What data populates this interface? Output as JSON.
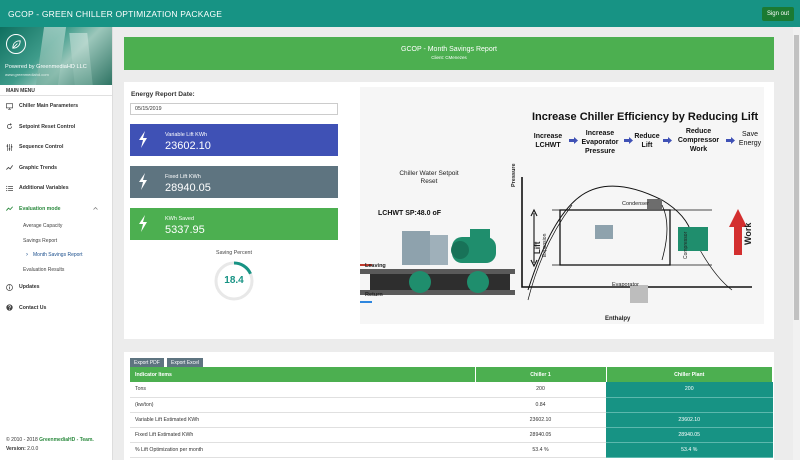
{
  "app": {
    "title": "GCOP - GREEN CHILLER OPTIMIZATION PACKAGE",
    "signout": "Sign out"
  },
  "brand": {
    "powered": "Powered by GreenmediaHD LLC",
    "site": "www.greenmediahd.com"
  },
  "sidebar": {
    "main_menu": "MAIN MENU",
    "items": [
      {
        "label": "Chiller Main Parameters",
        "icon": "monitor-icon"
      },
      {
        "label": "Setpoint Reset Control",
        "icon": "reset-icon"
      },
      {
        "label": "Sequence Control",
        "icon": "sliders-icon"
      },
      {
        "label": "Graphic Trends",
        "icon": "trend-icon"
      },
      {
        "label": "Additional Variables",
        "icon": "list-icon"
      },
      {
        "label": "Evaluation mode",
        "icon": "chart-line-icon"
      }
    ],
    "sub_items": [
      "Average Capacity",
      "Savings Report",
      "Month Savings Report",
      "Evaluation Results"
    ],
    "items_after": [
      {
        "label": "Updates",
        "icon": "info-icon"
      },
      {
        "label": "Contact Us",
        "icon": "help-icon"
      }
    ],
    "footer_copyright": "© 2010 - 2018 ",
    "footer_org": "GreenmediaHD - Team.",
    "footer_version_label": "Version: ",
    "footer_version": "2.0.0"
  },
  "report": {
    "title": "GCOP - Month Savings Report",
    "client": "Client: CMenezes"
  },
  "energy": {
    "date_label": "Energy Report Date:",
    "date_value": "05/15/2019",
    "variable_label": "Variable Lift KWh",
    "variable_value": "23602.10",
    "fixed_label": "Fixed Lift KWh",
    "fixed_value": "28940.05",
    "saved_label": "KWh Saved",
    "saved_value": "5337.95",
    "saving_percent_label": "Saving Percent",
    "saving_percent_value": "18.4",
    "saving_percent": 18.4
  },
  "diagram": {
    "title": "Increase Chiller Efficiency by Reducing Lift",
    "steps": [
      "Increase LCHWT",
      "Increase Evaporator Pressure",
      "Reduce Lift",
      "Reduce Compressor Work",
      "Save Energy"
    ],
    "setpoint_text": "Chiller Water Setpoit Reset",
    "lchwt_sp": "LCHWT SP:48.0 oF",
    "leaving": "Leaving",
    "return": "Return",
    "pressure": "Pressure",
    "lift": "Lift",
    "expansion": "Expansion",
    "condenser": "Condenser",
    "compressor": "Compressor",
    "evaporator": "Evaporator",
    "enthalpy": "Enthalpy",
    "work": "Work"
  },
  "table": {
    "export_pdf": "Export PDF",
    "export_excel": "Export Excel",
    "headers": [
      "Indicator Items",
      "Chiller 1",
      "Chiller Plant"
    ],
    "rows": [
      [
        "Tons",
        "200",
        "200"
      ],
      [
        "(kw/ton)",
        "0.84",
        ""
      ],
      [
        "Variable Lift Estimated KWh",
        "23602.10",
        "23602.10"
      ],
      [
        "Fixed Lift Estimated KWh",
        "28940.05",
        "28940.05"
      ],
      [
        "% Lift Optimization per month",
        "53.4 %",
        "53.4 %"
      ]
    ]
  },
  "colors": {
    "teal": "#179384",
    "green": "#4caf50",
    "indigo": "#3f51b5",
    "slate": "#5e7480"
  }
}
